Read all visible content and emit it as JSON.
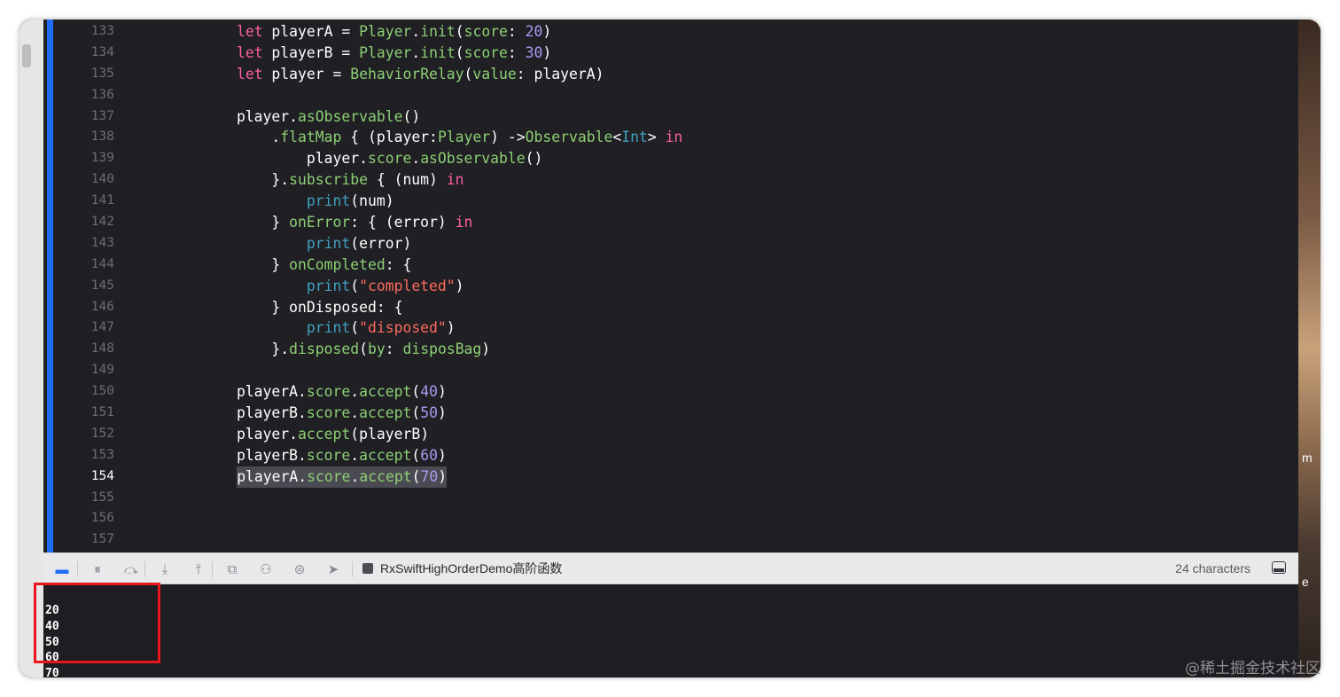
{
  "editor": {
    "current_line": "154",
    "lines": [
      {
        "n": "133",
        "segs": [
          {
            "t": "        "
          },
          {
            "t": "let",
            "c": "kw"
          },
          {
            "t": " playerA = "
          },
          {
            "t": "Player",
            "c": "tp"
          },
          {
            "t": "."
          },
          {
            "t": "init",
            "c": "fn"
          },
          {
            "t": "("
          },
          {
            "t": "score",
            "c": "fn"
          },
          {
            "t": ": "
          },
          {
            "t": "20",
            "c": "num"
          },
          {
            "t": ")"
          }
        ]
      },
      {
        "n": "134",
        "segs": [
          {
            "t": "        "
          },
          {
            "t": "let",
            "c": "kw"
          },
          {
            "t": " playerB = "
          },
          {
            "t": "Player",
            "c": "tp"
          },
          {
            "t": "."
          },
          {
            "t": "init",
            "c": "fn"
          },
          {
            "t": "("
          },
          {
            "t": "score",
            "c": "fn"
          },
          {
            "t": ": "
          },
          {
            "t": "30",
            "c": "num"
          },
          {
            "t": ")"
          }
        ]
      },
      {
        "n": "135",
        "segs": [
          {
            "t": "        "
          },
          {
            "t": "let",
            "c": "kw"
          },
          {
            "t": " player = "
          },
          {
            "t": "BehaviorRelay",
            "c": "tp"
          },
          {
            "t": "("
          },
          {
            "t": "value",
            "c": "fn"
          },
          {
            "t": ": playerA)"
          }
        ]
      },
      {
        "n": "136",
        "segs": []
      },
      {
        "n": "137",
        "segs": [
          {
            "t": "        player."
          },
          {
            "t": "asObservable",
            "c": "fn"
          },
          {
            "t": "()"
          }
        ]
      },
      {
        "n": "138",
        "segs": [
          {
            "t": "            ."
          },
          {
            "t": "flatMap",
            "c": "fn"
          },
          {
            "t": " { (player:"
          },
          {
            "t": "Player",
            "c": "tp"
          },
          {
            "t": ") ->"
          },
          {
            "t": "Observable",
            "c": "tp"
          },
          {
            "t": "<"
          },
          {
            "t": "Int",
            "c": "sys"
          },
          {
            "t": "> "
          },
          {
            "t": "in",
            "c": "kw"
          }
        ]
      },
      {
        "n": "139",
        "segs": [
          {
            "t": "                player."
          },
          {
            "t": "score",
            "c": "fn"
          },
          {
            "t": "."
          },
          {
            "t": "asObservable",
            "c": "fn"
          },
          {
            "t": "()"
          }
        ]
      },
      {
        "n": "140",
        "segs": [
          {
            "t": "            }."
          },
          {
            "t": "subscribe",
            "c": "fn"
          },
          {
            "t": " { (num) "
          },
          {
            "t": "in",
            "c": "kw"
          }
        ]
      },
      {
        "n": "141",
        "segs": [
          {
            "t": "                "
          },
          {
            "t": "print",
            "c": "sys"
          },
          {
            "t": "(num)"
          }
        ]
      },
      {
        "n": "142",
        "segs": [
          {
            "t": "            } "
          },
          {
            "t": "onError",
            "c": "fn"
          },
          {
            "t": ": { (error) "
          },
          {
            "t": "in",
            "c": "kw"
          }
        ]
      },
      {
        "n": "143",
        "segs": [
          {
            "t": "                "
          },
          {
            "t": "print",
            "c": "sys"
          },
          {
            "t": "(error)"
          }
        ]
      },
      {
        "n": "144",
        "segs": [
          {
            "t": "            } "
          },
          {
            "t": "onCompleted",
            "c": "fn"
          },
          {
            "t": ": {"
          }
        ]
      },
      {
        "n": "145",
        "segs": [
          {
            "t": "                "
          },
          {
            "t": "print",
            "c": "sys"
          },
          {
            "t": "("
          },
          {
            "t": "\"completed\"",
            "c": "str"
          },
          {
            "t": ")"
          }
        ]
      },
      {
        "n": "146",
        "segs": [
          {
            "t": "            } onDisposed: {"
          }
        ]
      },
      {
        "n": "147",
        "segs": [
          {
            "t": "                "
          },
          {
            "t": "print",
            "c": "sys"
          },
          {
            "t": "("
          },
          {
            "t": "\"disposed\"",
            "c": "str"
          },
          {
            "t": ")"
          }
        ]
      },
      {
        "n": "148",
        "segs": [
          {
            "t": "            }."
          },
          {
            "t": "disposed",
            "c": "fn"
          },
          {
            "t": "("
          },
          {
            "t": "by",
            "c": "fn"
          },
          {
            "t": ": "
          },
          {
            "t": "disposBag",
            "c": "fn"
          },
          {
            "t": ")"
          }
        ]
      },
      {
        "n": "149",
        "segs": []
      },
      {
        "n": "150",
        "segs": [
          {
            "t": "        playerA."
          },
          {
            "t": "score",
            "c": "fn"
          },
          {
            "t": "."
          },
          {
            "t": "accept",
            "c": "fn"
          },
          {
            "t": "("
          },
          {
            "t": "40",
            "c": "num"
          },
          {
            "t": ")"
          }
        ]
      },
      {
        "n": "151",
        "segs": [
          {
            "t": "        playerB."
          },
          {
            "t": "score",
            "c": "fn"
          },
          {
            "t": "."
          },
          {
            "t": "accept",
            "c": "fn"
          },
          {
            "t": "("
          },
          {
            "t": "50",
            "c": "num"
          },
          {
            "t": ")"
          }
        ]
      },
      {
        "n": "152",
        "segs": [
          {
            "t": "        player."
          },
          {
            "t": "accept",
            "c": "fn"
          },
          {
            "t": "(playerB)"
          }
        ]
      },
      {
        "n": "153",
        "segs": [
          {
            "t": "        playerB."
          },
          {
            "t": "score",
            "c": "fn"
          },
          {
            "t": "."
          },
          {
            "t": "accept",
            "c": "fn"
          },
          {
            "t": "("
          },
          {
            "t": "60",
            "c": "num"
          },
          {
            "t": ")"
          }
        ]
      },
      {
        "n": "154",
        "selected": true,
        "segs": [
          {
            "t": "playerA."
          },
          {
            "t": "score",
            "c": "fn"
          },
          {
            "t": "."
          },
          {
            "t": "accept",
            "c": "fn"
          },
          {
            "t": "("
          },
          {
            "t": "70",
            "c": "num"
          },
          {
            "t": ")"
          }
        ],
        "indent": "        "
      },
      {
        "n": "155",
        "segs": []
      },
      {
        "n": "156",
        "segs": []
      },
      {
        "n": "157",
        "segs": []
      }
    ],
    "colors": {
      "keyword": "#fc5fa3",
      "type": "#8dcf73",
      "number": "#a89bf0",
      "string": "#fc6a5d",
      "system": "#41a1c0",
      "background": "#1f1f24"
    }
  },
  "debug_bar": {
    "buttons": [
      {
        "name": "breakpoints-toggle-icon",
        "glyph": "▬"
      },
      {
        "name": "pause-icon",
        "glyph": "⏸"
      },
      {
        "name": "step-over-icon",
        "glyph": "⤼"
      },
      {
        "name": "step-into-icon",
        "glyph": "⤓"
      },
      {
        "name": "step-out-icon",
        "glyph": "⤒"
      },
      {
        "name": "view-hierarchy-icon",
        "glyph": "⧉"
      },
      {
        "name": "memory-graph-icon",
        "glyph": "⚇"
      },
      {
        "name": "environment-overrides-icon",
        "glyph": "⊜"
      },
      {
        "name": "simulate-location-icon",
        "glyph": "➤"
      }
    ],
    "scheme": "RxSwiftHighOrderDemo高阶函数",
    "char_count": "24 characters"
  },
  "console": {
    "lines": [
      "20",
      "40",
      "50",
      "60",
      "70"
    ]
  },
  "right_fragments": [
    "m",
    "e"
  ],
  "watermark": "@稀土掘金技术社区"
}
